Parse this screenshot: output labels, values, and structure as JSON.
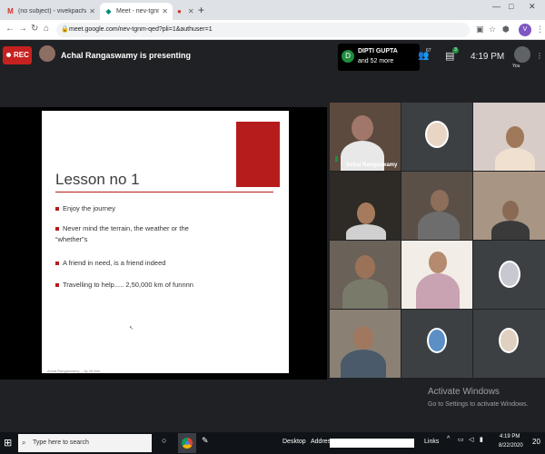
{
  "browser": {
    "tabs": [
      {
        "label": "(no subject) - vivekpachauri@it...",
        "icon": "gmail-icon",
        "active": false
      },
      {
        "label": "Meet - nev-tgnm-qed",
        "icon": "meet-icon",
        "active": true
      },
      {
        "label": "",
        "icon": "recording-icon",
        "active": false
      }
    ],
    "new_tab": "+",
    "url": "meet.google.com/nev-tgnm-qed?pli=1&authuser=1",
    "profile_initial": "V"
  },
  "meet": {
    "rec_label": "REC",
    "presenter_text": "Achal Rangaswamy is presenting",
    "participant_card": {
      "initial": "D",
      "name": "DIPTI GUPTA",
      "more": "and 52 more"
    },
    "people_count": "67",
    "chat_badge": "3",
    "time": "4:19 PM",
    "you_label": "You"
  },
  "slide": {
    "title": "Lesson no 1",
    "bullets": [
      "Enjoy the journey",
      "Never mind the terrain, the weather or the “whether”s",
      "A friend in need, is a friend indeed",
      "Travelling to help..... 2,50,000 km of funnnn"
    ],
    "footer": "Achal Rangaswamy, ...ity 26 Mar",
    "accent_color": "#b71c1c"
  },
  "grid": {
    "speaker_label": "Achal Rangaswamy"
  },
  "watermark": {
    "line1": "Activate Windows",
    "line2": "Go to Settings to activate Windows."
  },
  "taskbar": {
    "search_placeholder": "Type here to search",
    "desktop_label": "Desktop",
    "address_label": "Address",
    "links_label": "Links",
    "time": "4:19 PM",
    "date": "8/22/2020",
    "notif_count": "20"
  }
}
